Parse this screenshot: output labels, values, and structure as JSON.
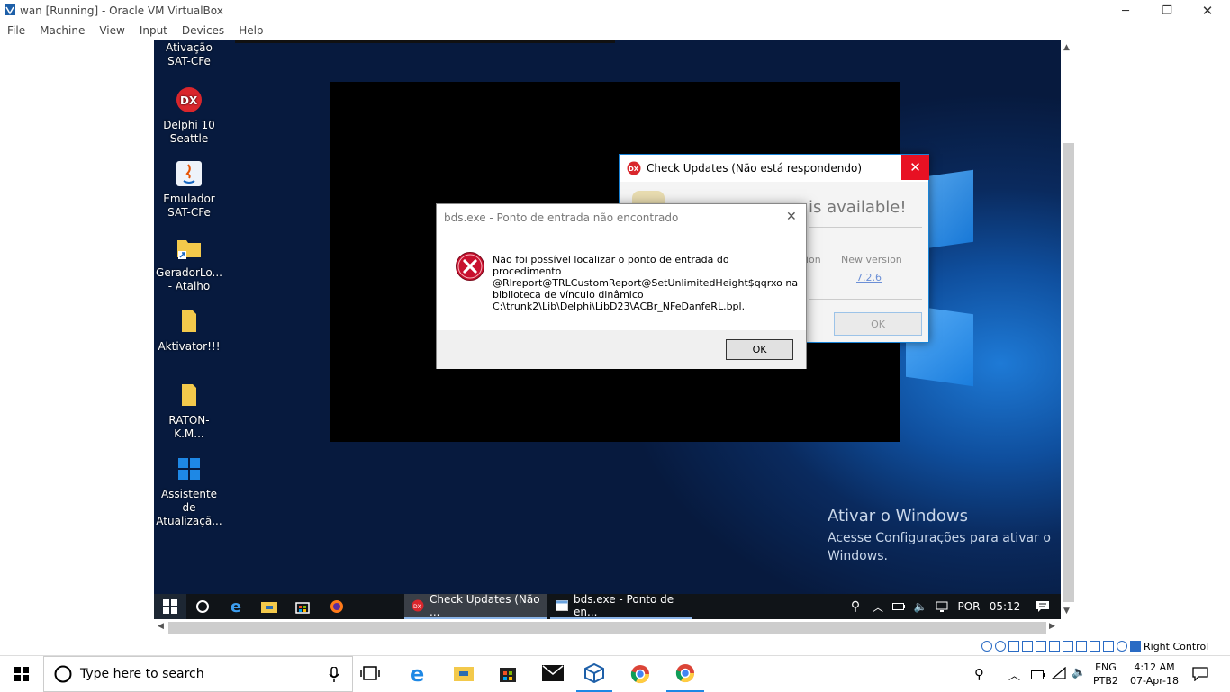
{
  "host_window": {
    "title": "wan [Running] - Oracle VM VirtualBox",
    "menu": [
      "File",
      "Machine",
      "View",
      "Input",
      "Devices",
      "Help"
    ],
    "controls": {
      "minimize": "─",
      "restore": "❐",
      "close": "✕"
    },
    "status_text": "Right Control"
  },
  "guest": {
    "desktop_icons": [
      {
        "label": "Ativação\nSAT-CFe",
        "icon": "app-icon"
      },
      {
        "label": "Delphi 10\nSeattle",
        "icon": "delphi-icon"
      },
      {
        "label": "Emulador\nSAT-CFe",
        "icon": "java-icon"
      },
      {
        "label": "GeradorLo...\n- Atalho",
        "icon": "folder-shortcut-icon"
      },
      {
        "label": "Aktivator!!!",
        "icon": "folder-icon"
      },
      {
        "label": "RATON-K.M...",
        "icon": "folder-icon"
      },
      {
        "label": "Assistente de\nAtualizaçã...",
        "icon": "windows-update-icon"
      }
    ],
    "watermark": {
      "title": "Ativar o Windows",
      "line": "Acesse Configurações para ativar o\nWindows."
    },
    "check_updates": {
      "title": "Check Updates (Não está respondendo)",
      "headline_partial": "is available!",
      "col_partial": "ion",
      "new_version_label": "New version",
      "new_version": "7.2.6",
      "ok": "OK"
    },
    "error_dialog": {
      "title": "bds.exe - Ponto de entrada não encontrado",
      "message": "Não foi possível localizar o ponto de entrada do\nprocedimento\n@Rlreport@TRLCustomReport@SetUnlimitedHeight$qqrxo na\nbiblioteca de vínculo dinâmico\nC:\\trunk2\\Lib\\Delphi\\LibD23\\ACBr_NFeDanfeRL.bpl.",
      "ok": "OK"
    },
    "taskbar": {
      "tasks": [
        {
          "label": "Check Updates (Não ..."
        },
        {
          "label": "bds.exe - Ponto de en..."
        }
      ],
      "lang": "POR",
      "time": "05:12"
    }
  },
  "host_taskbar": {
    "search_placeholder": "Type here to search",
    "lang_top": "ENG",
    "lang_bottom": "PTB2",
    "time": "4:12 AM",
    "date": "07-Apr-18"
  },
  "colors": {
    "accent": "#1883d7",
    "close_red": "#e81123",
    "error_red": "#c8102e"
  }
}
